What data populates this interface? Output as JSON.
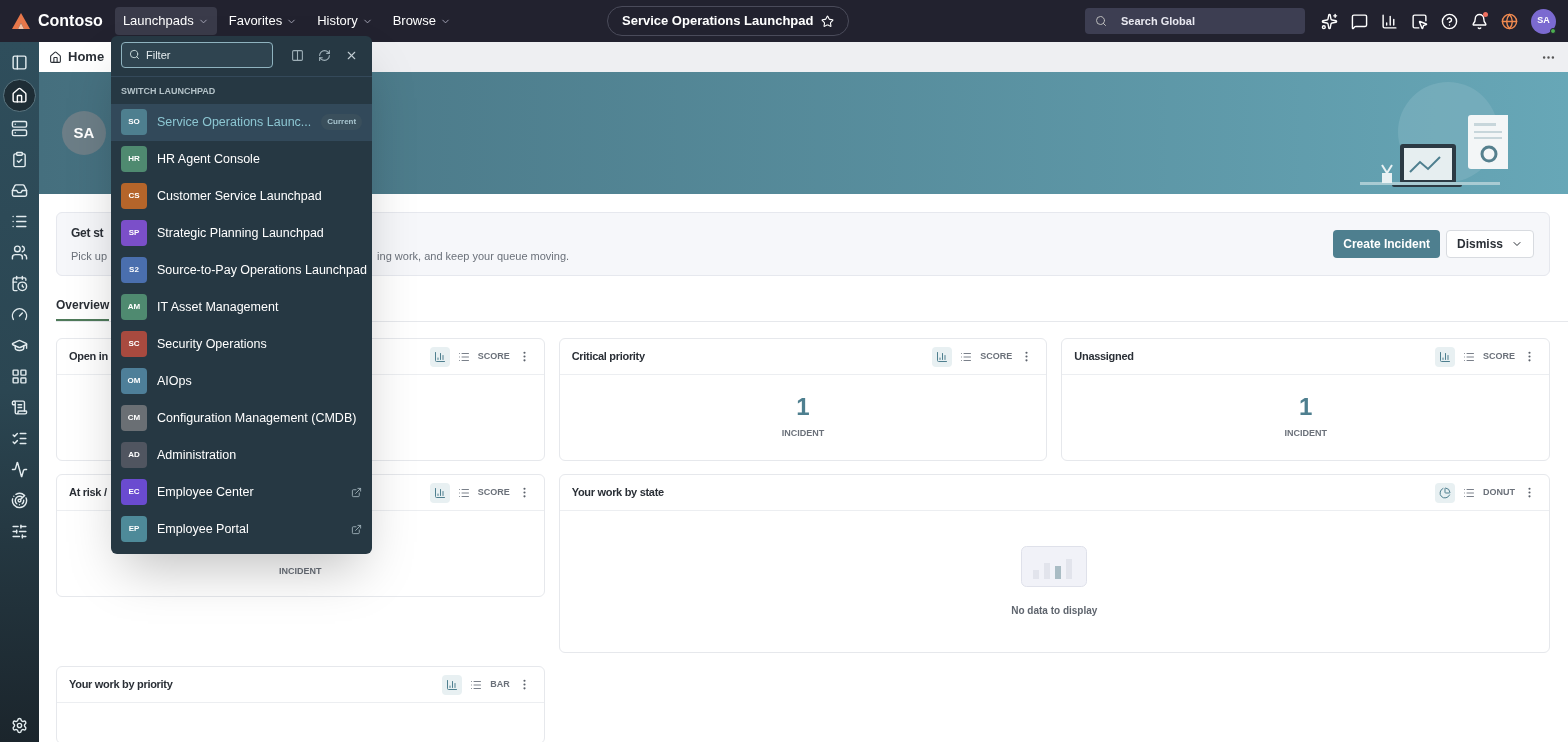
{
  "top_bar": {
    "brand": "Contoso",
    "menus": [
      {
        "label": "Launchpads",
        "selected": true
      },
      {
        "label": "Favorites",
        "selected": false
      },
      {
        "label": "History",
        "selected": false
      },
      {
        "label": "Browse",
        "selected": false
      }
    ],
    "page_title": "Service Operations Launchpad",
    "search": {
      "placeholder": "Search Global"
    },
    "notifications_unread": true,
    "avatar": "SA"
  },
  "tab_bar": {
    "tabs": [
      {
        "label": "Home",
        "selected": true
      }
    ]
  },
  "hero": {
    "avatar": "SA"
  },
  "get_started": {
    "title": "Get st",
    "description_parts": [
      "Pick up",
      "ing work, and keep your queue moving."
    ],
    "primary_button": "Create Incident",
    "secondary_button": "Dismiss"
  },
  "content_tabs": [
    {
      "label": "Overview",
      "selected": true
    }
  ],
  "widgets": [
    {
      "title": "Open in",
      "kind": "score",
      "view_label": "SCORE"
    },
    {
      "title": "Critical priority",
      "kind": "score",
      "view_label": "SCORE",
      "value": "1",
      "unit": "INCIDENT"
    },
    {
      "title": "Unassigned",
      "kind": "score",
      "view_label": "SCORE",
      "value": "1",
      "unit": "INCIDENT"
    },
    {
      "title": "At risk /",
      "kind": "score",
      "view_label": "SCORE",
      "unit": "INCIDENT"
    },
    {
      "title": "Your work by state",
      "kind": "donut",
      "view_label": "DONUT",
      "empty_text": "No data to display"
    },
    {
      "title": "Your work by priority",
      "kind": "bar",
      "view_label": "BAR"
    }
  ],
  "launchpad_menu": {
    "filter": {
      "placeholder": "Filter"
    },
    "heading": "SWITCH LAUNCHPAD",
    "items": [
      {
        "abbr": "SO",
        "name": "Service Operations Launc...",
        "color": "#4e7f8f",
        "selected": true,
        "badge": "Current",
        "external": false
      },
      {
        "abbr": "HR",
        "name": "HR Agent Console",
        "color": "#4f8a70",
        "selected": false,
        "external": false
      },
      {
        "abbr": "CS",
        "name": "Customer Service Launchpad",
        "color": "#b5652a",
        "selected": false,
        "external": false
      },
      {
        "abbr": "SP",
        "name": "Strategic Planning Launchpad",
        "color": "#7b4fc9",
        "selected": false,
        "external": false
      },
      {
        "abbr": "S2",
        "name": "Source-to-Pay Operations Launchpad",
        "color": "#4a6fae",
        "selected": false,
        "external": false
      },
      {
        "abbr": "AM",
        "name": "IT Asset Management",
        "color": "#4f8a70",
        "selected": false,
        "external": false
      },
      {
        "abbr": "SC",
        "name": "Security Operations",
        "color": "#a84a3f",
        "selected": false,
        "external": false
      },
      {
        "abbr": "OM",
        "name": "AIOps",
        "color": "#4e7f99",
        "selected": false,
        "external": false
      },
      {
        "abbr": "CM",
        "name": "Configuration Management (CMDB)",
        "color": "#6a6f74",
        "selected": false,
        "external": false
      },
      {
        "abbr": "AD",
        "name": "Administration",
        "color": "#505560",
        "selected": false,
        "external": false
      },
      {
        "abbr": "EC",
        "name": "Employee Center",
        "color": "#6a4bd0",
        "selected": false,
        "external": true
      },
      {
        "abbr": "EP",
        "name": "Employee Portal",
        "color": "#4e8a99",
        "selected": false,
        "external": true
      }
    ]
  }
}
